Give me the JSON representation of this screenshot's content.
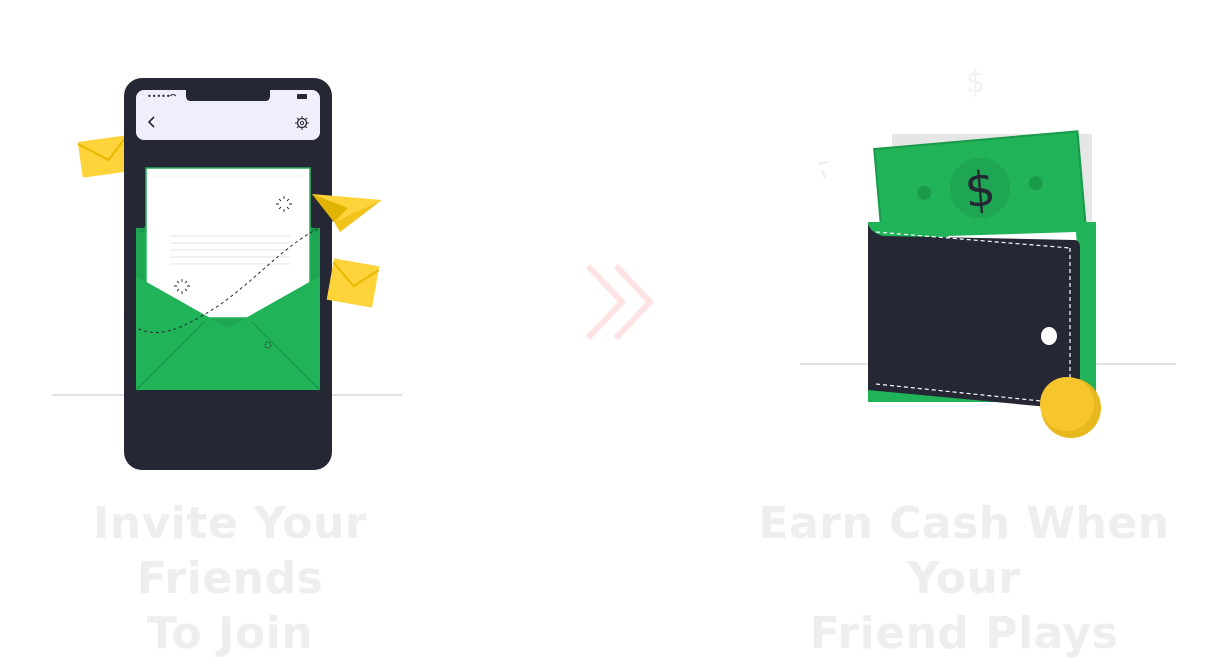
{
  "steps": [
    {
      "id": "invite",
      "title_line1": "Invite Your Friends",
      "title_line2": "To Join",
      "illustration": "phone-envelope-invite"
    },
    {
      "id": "earn",
      "title_line1": "Earn Cash When Your",
      "title_line2": "Friend Plays",
      "illustration": "wallet-cash-coin"
    }
  ],
  "phone": {
    "status_dots": "•••••",
    "back_icon": "chevron-left-icon",
    "settings_icon": "gear-icon"
  },
  "bill": {
    "symbol": "$"
  },
  "connector_icon": "double-chevron-right-icon",
  "colors": {
    "phone_body": "#262735",
    "screen_header": "#f1eefb",
    "envelope_green": "#20b358",
    "bill_green": "#20b358",
    "mail_yellow": "#ffd43b",
    "coin_gold": "#f6c62c",
    "caption_text": "#eeeeee",
    "arrow_tint": "#ffe3e3"
  }
}
